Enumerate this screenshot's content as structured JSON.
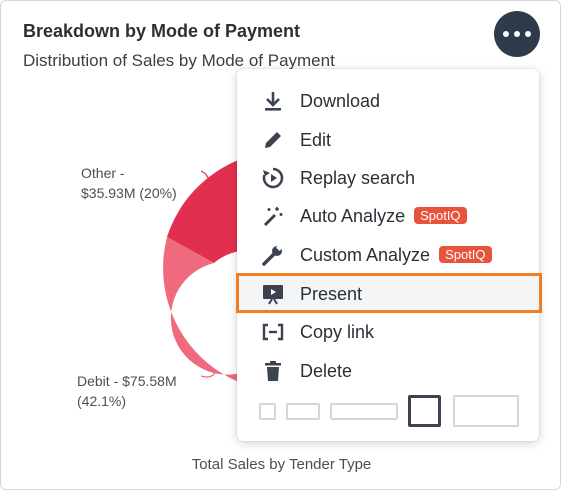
{
  "card": {
    "title": "Breakdown by Mode of Payment",
    "subtitle": "Distribution of Sales by Mode of Payment",
    "more_icon": "more-horizontal-icon"
  },
  "chart_data": {
    "type": "pie",
    "title": "Total Sales by Tender Type",
    "slices": [
      {
        "label": "Other",
        "value": 35.93,
        "percent": 20,
        "display": "Other -\n$35.93M (20%)",
        "color": "#e1304f"
      },
      {
        "label": "Debit",
        "value": 75.58,
        "percent": 42.1,
        "display": "Debit - $75.58M\n(42.1%)",
        "color": "#ee6a7c"
      }
    ]
  },
  "labels": {
    "other_line1": "Other -",
    "other_line2": "$35.93M (20%)",
    "debit_line1": "Debit - $75.58M",
    "debit_line2": "(42.1%)"
  },
  "menu": {
    "items": [
      {
        "label": "Download",
        "icon": "download-icon"
      },
      {
        "label": "Edit",
        "icon": "pencil-icon"
      },
      {
        "label": "Replay search",
        "icon": "replay-icon"
      },
      {
        "label": "Auto Analyze",
        "icon": "magic-wand-icon",
        "badge": "SpotIQ"
      },
      {
        "label": "Custom Analyze",
        "icon": "wrench-icon",
        "badge": "SpotIQ"
      },
      {
        "label": "Present",
        "icon": "present-icon",
        "highlighted": true
      },
      {
        "label": "Copy link",
        "icon": "copy-link-icon"
      },
      {
        "label": "Delete",
        "icon": "trash-icon"
      }
    ],
    "size_options": [
      "xs",
      "s",
      "m",
      "l",
      "xl"
    ],
    "selected_size": "l"
  },
  "colors": {
    "accent_highlight": "#f07f22",
    "badge": "#e8533b",
    "button": "#2f3a4a"
  }
}
